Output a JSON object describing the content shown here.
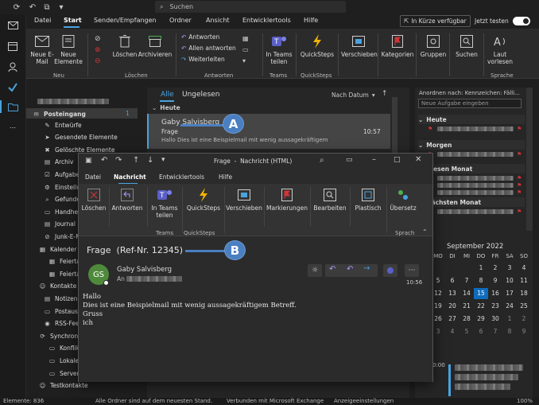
{
  "titlebar": {
    "search_placeholder": "Suchen"
  },
  "tabs": [
    "Datei",
    "Start",
    "Senden/Empfangen",
    "Ordner",
    "Ansicht",
    "Entwicklertools",
    "Hilfe"
  ],
  "top_right": {
    "coming_soon": "In Kürze verfügbar",
    "try_now": "Jetzt testen"
  },
  "ribbon": {
    "new_mail": "Neue E-Mail",
    "new_items": "Neue Elemente",
    "group_new": "Neu",
    "delete": "Löschen",
    "archive": "Archivieren",
    "group_delete": "Löschen",
    "reply": "Antworten",
    "reply_all": "Allen antworten",
    "forward": "Weiterleiten",
    "group_respond": "Antworten",
    "in_teams": "In Teams teilen",
    "group_teams": "Teams",
    "quicksteps": "QuickSteps",
    "group_quicksteps": "QuickSteps",
    "move": "Verschieben",
    "categories": "Kategorien",
    "groups": "Gruppen",
    "search": "Suchen",
    "read_aloud": "Laut vorlesen",
    "group_speech": "Sprache"
  },
  "folders": {
    "inbox": "Posteingang",
    "inbox_count": "1",
    "items": [
      "Entwürfe",
      "Gesendete Elemente",
      "Gelöschte Elemente",
      "Archiv",
      "Aufgaben",
      "Einstellungen",
      "Gefunden",
      "Handheld",
      "Journal",
      "Junk-E-M",
      "Kalender",
      "Feiertag",
      "Feiertag",
      "Kontakte",
      "Notizen",
      "Postausg",
      "RSS-Feeds",
      "Synchron",
      "Konflikt",
      "Lokale F",
      "Serverfe",
      "Testkontakte"
    ]
  },
  "msglist": {
    "filter_all": "Alle",
    "filter_unread": "Ungelesen",
    "sort": "Nach Datum",
    "group_today": "Heute",
    "message": {
      "sender": "Gaby Salvisberg",
      "subject": "Frage",
      "preview": "Hallo  Dies ist eine Beispielmail mit wenig aussagekräftigem",
      "time": "10:57"
    }
  },
  "todo": {
    "arrange": "Anordnen nach: Kennzeichen: Fälli...",
    "new_task": "Neue Aufgabe eingeben",
    "groups": [
      "Heute",
      "Morgen",
      "Diesen Monat",
      "Nächsten Monat"
    ],
    "calendar_title": "September 2022",
    "weekdays": [
      "MO",
      "DI",
      "MI",
      "DO",
      "FR",
      "SA",
      "SO"
    ],
    "weeks": [
      [
        "",
        "",
        "",
        "1",
        "2",
        "3",
        "4"
      ],
      [
        "5",
        "6",
        "7",
        "8",
        "9",
        "10",
        "11"
      ],
      [
        "12",
        "13",
        "14",
        "15",
        "16",
        "17",
        "18"
      ],
      [
        "19",
        "20",
        "21",
        "22",
        "23",
        "24",
        "25"
      ],
      [
        "26",
        "27",
        "28",
        "29",
        "30",
        "1",
        "2"
      ],
      [
        "3",
        "4",
        "5",
        "6",
        "7",
        "8",
        "9"
      ]
    ],
    "today": "15",
    "time_marker": "0:00"
  },
  "status": {
    "items": "Elemente: 836",
    "uptodate": "Alle Ordner sind auf dem neuesten Stand.",
    "connected": "Verbunden mit Microsoft Exchange",
    "display": "Anzeigeeinstellungen",
    "zoom": "100%"
  },
  "win": {
    "title": "Frage  -  Nachricht (HTML)",
    "tabs": [
      "Datei",
      "Nachricht",
      "Entwicklertools",
      "Hilfe"
    ],
    "ribbon": {
      "delete": "Löschen",
      "respond": "Antworten",
      "in_teams": "In Teams teilen",
      "quicksteps": "QuickSteps",
      "move": "Verschieben",
      "tags": "Markierungen",
      "edit": "Bearbeiten",
      "immersive": "Plastisch",
      "translate": "Übersetz",
      "group_teams": "Teams",
      "group_quicksteps": "QuickSteps",
      "group_speech": "Sprach"
    },
    "subject": "Frage  (Ref-Nr. 12345)",
    "sender": "Gaby Salvisberg",
    "initials": "GS",
    "to_label": "An",
    "time": "10:56",
    "body": [
      "Hallo",
      "Dies ist eine Beispielmail mit wenig aussagekräftigem Betreff.",
      "Gruss",
      "ich"
    ]
  },
  "callouts": {
    "a": "A",
    "b": "B"
  },
  "colors": {
    "accent": "#4aa3df",
    "callout": "#4a7fc1",
    "flag": "#d13438",
    "avatar": "#4f8a3c"
  }
}
